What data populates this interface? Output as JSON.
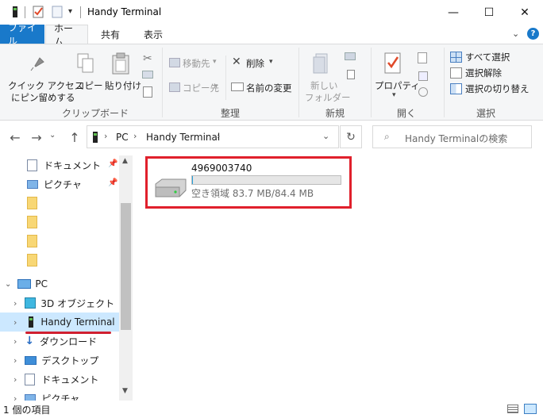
{
  "window": {
    "title": "Handy Terminal",
    "controls": [
      "—",
      "☐",
      "✕"
    ]
  },
  "ribbon": {
    "tabs": [
      "ファイル",
      "ホーム",
      "共有",
      "表示"
    ],
    "groups": {
      "clipboard": {
        "label": "クリップボード",
        "pin_line1": "クイック アクセス",
        "pin_line2": "にピン留めする",
        "copy": "コピー",
        "paste": "貼り付け"
      },
      "organize": {
        "label": "整理",
        "move_to": "移動先",
        "copy_to": "コピー先",
        "delete": "削除",
        "rename": "名前の変更"
      },
      "new": {
        "label": "新規",
        "new_folder_line1": "新しい",
        "new_folder_line2": "フォルダー"
      },
      "open": {
        "label": "開く",
        "properties": "プロパティ"
      },
      "select": {
        "label": "選択",
        "select_all": "すべて選択",
        "select_none": "選択解除",
        "invert": "選択の切り替え"
      }
    }
  },
  "address": {
    "crumbs": [
      "PC",
      "Handy Terminal"
    ],
    "search_placeholder": "Handy Terminalの検索"
  },
  "navpane": {
    "items": [
      {
        "label": "ドキュメント",
        "pinned": true
      },
      {
        "label": "ピクチャ",
        "pinned": true
      },
      {
        "label": ""
      },
      {
        "label": ""
      },
      {
        "label": ""
      },
      {
        "label": ""
      },
      {
        "label": "PC"
      },
      {
        "label": "3D オブジェクト"
      },
      {
        "label": "Handy Terminal"
      },
      {
        "label": "ダウンロード"
      },
      {
        "label": "デスクトップ"
      },
      {
        "label": "ドキュメント"
      },
      {
        "label": "ピクチャ"
      }
    ]
  },
  "drive": {
    "name": "4969003740",
    "free_text": "空き領域 83.7 MB/84.4 MB",
    "used_fraction": 0.008
  },
  "statusbar": {
    "count": "1 個の項目"
  },
  "colors": {
    "accent": "#1979ca",
    "highlight_border": "#e0202c",
    "selected_bg": "#cce8ff"
  }
}
